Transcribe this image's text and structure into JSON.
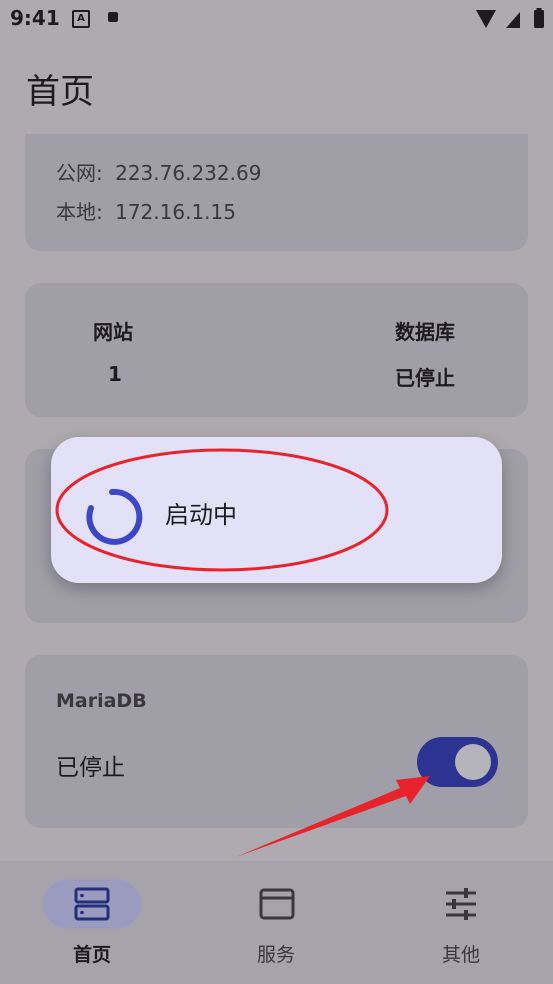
{
  "status_bar": {
    "time": "9:41",
    "a_icon_letter": "A"
  },
  "page": {
    "title": "首页"
  },
  "ip_card": {
    "public_label": "公网:",
    "public_value": "223.76.232.69",
    "local_label": "本地:",
    "local_value": "172.16.1.15"
  },
  "stats_card": {
    "website_label": "网站",
    "website_value": "1",
    "database_label": "数据库",
    "database_value": "已停止"
  },
  "dialog": {
    "text": "启动中"
  },
  "maria_card": {
    "title": "MariaDB",
    "status": "已停止",
    "toggle_on": true
  },
  "bottom_nav": {
    "items": [
      {
        "label": "首页",
        "icon": "server-icon",
        "active": true
      },
      {
        "label": "服务",
        "icon": "window-icon",
        "active": false
      },
      {
        "label": "其他",
        "icon": "sliders-icon",
        "active": false
      }
    ]
  },
  "colors": {
    "accent": "#2b3490",
    "annotation_red": "#e8232b",
    "dialog_bg": "#e3e1f8"
  }
}
